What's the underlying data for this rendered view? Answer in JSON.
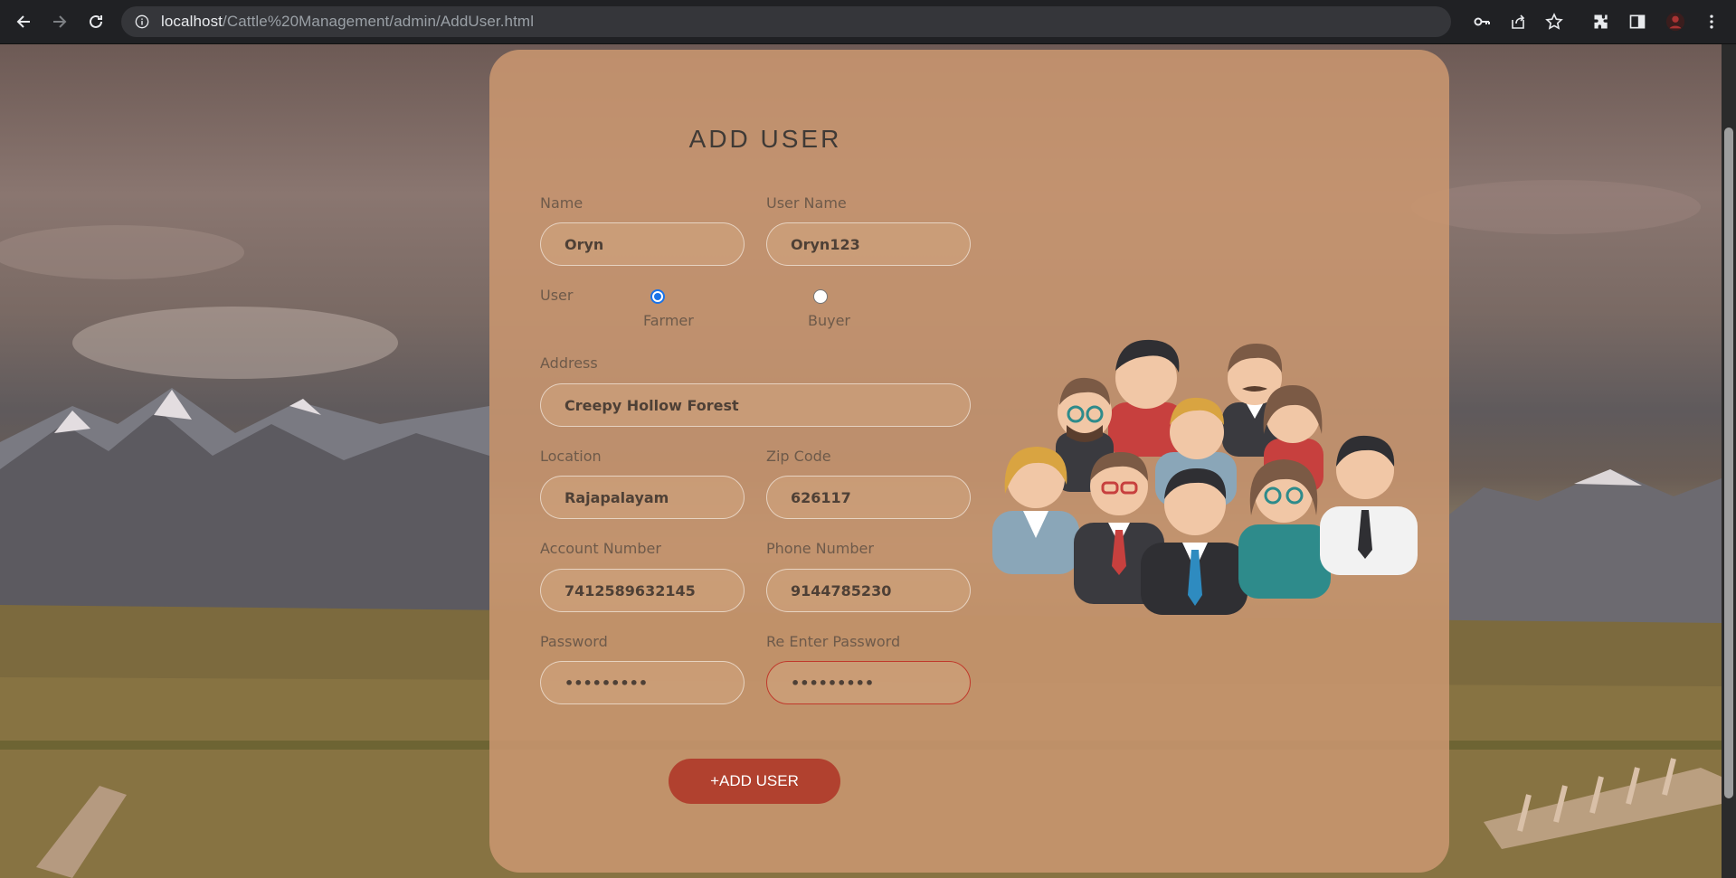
{
  "browser": {
    "url_host": "localhost",
    "url_path": "/Cattle%20Management/admin/AddUser.html"
  },
  "form": {
    "title": "ADD USER",
    "name": {
      "label": "Name",
      "value": "Oryn"
    },
    "username": {
      "label": "User Name",
      "value": "Oryn123"
    },
    "user_type": {
      "label": "User",
      "options": [
        {
          "label": "Farmer",
          "selected": true
        },
        {
          "label": "Buyer",
          "selected": false
        }
      ]
    },
    "address": {
      "label": "Address",
      "value": "Creepy Hollow Forest"
    },
    "location": {
      "label": "Location",
      "value": "Rajapalayam"
    },
    "zip": {
      "label": "Zip Code",
      "value": "626117"
    },
    "account": {
      "label": "Account Number",
      "value": "7412589632145"
    },
    "phone": {
      "label": "Phone Number",
      "value": "9144785230"
    },
    "password": {
      "label": "Password",
      "value": "•••••••••"
    },
    "reenter": {
      "label": "Re Enter Password",
      "value": "•••••••••"
    },
    "submit_label": "+ADD USER"
  },
  "colors": {
    "card": "#c99670",
    "button": "#b1412f",
    "error_border": "#c0392b",
    "radio_selected": "#1a73e8"
  },
  "icons": [
    "back-arrow-icon",
    "forward-arrow-icon",
    "reload-icon",
    "info-icon",
    "key-icon",
    "share-icon",
    "star-icon",
    "extensions-icon",
    "side-panel-icon",
    "profile-avatar-icon",
    "menu-kebab-icon"
  ]
}
